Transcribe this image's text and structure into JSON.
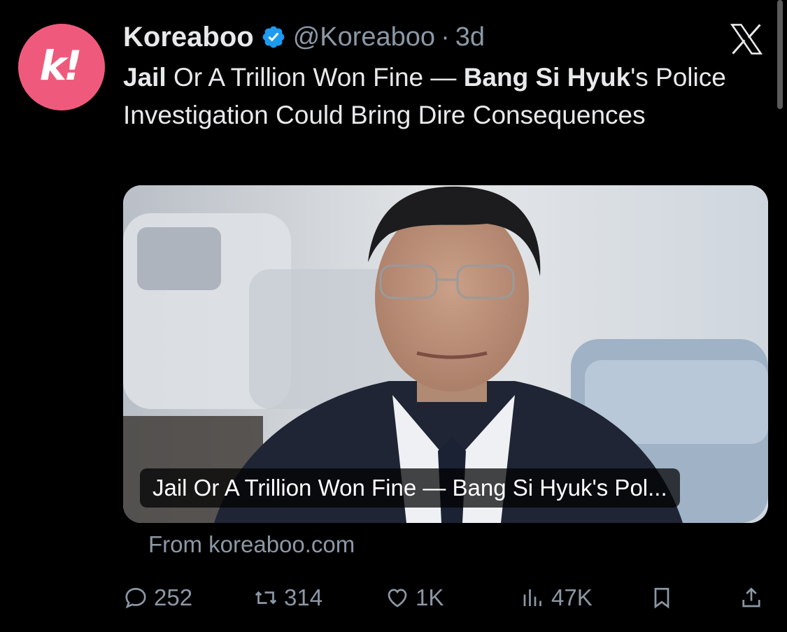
{
  "tweet": {
    "avatar_glyph": "k!",
    "display_name": "Koreaboo",
    "handle": "@Koreaboo",
    "separator": "·",
    "time": "3d",
    "headline": {
      "part1_bold": "Jail",
      "part2": " Or A Trillion Won Fine — ",
      "part3_bold": "Bang Si Hyuk",
      "part4": "'s Police Investigation Could Bring Dire Consequences"
    }
  },
  "card": {
    "caption": "Jail Or A Trillion Won Fine — Bang Si Hyuk's Pol..."
  },
  "source": "From koreaboo.com",
  "actions": {
    "replies": "252",
    "retweets": "314",
    "likes": "1K",
    "views": "47K"
  },
  "colors": {
    "background": "#000000",
    "avatar": "#ef5a7c",
    "verified": "#1d9bf0",
    "text_primary": "#e7e9ea",
    "text_secondary": "#8b98a5"
  },
  "icons": [
    "verified-badge-icon",
    "x-logo-icon",
    "reply-icon",
    "retweet-icon",
    "like-icon",
    "views-icon",
    "bookmark-icon",
    "share-icon"
  ]
}
